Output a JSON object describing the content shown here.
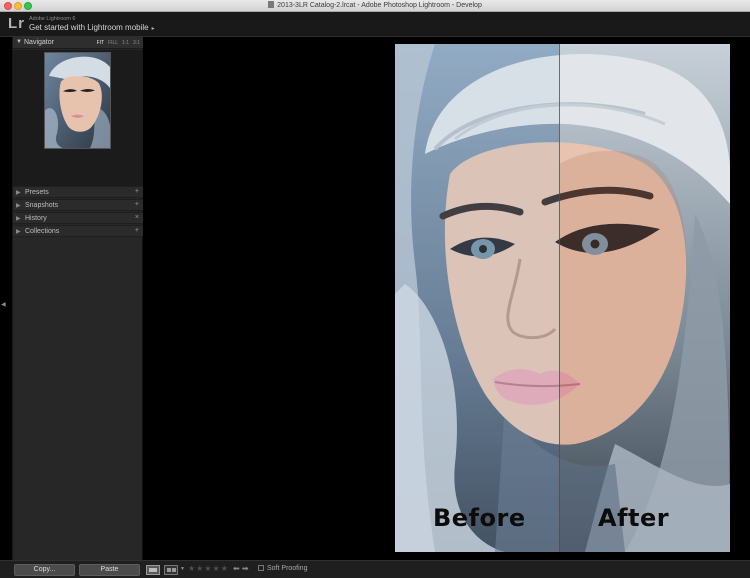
{
  "window": {
    "title": "2013-3LR Catalog-2.lrcat - Adobe Photoshop Lightroom - Develop"
  },
  "identity_plate": {
    "logo": "Lr",
    "version": "Adobe Lightroom 6",
    "mobile_link": "Get started with Lightroom mobile",
    "caret": "▸"
  },
  "navigator": {
    "title": "Navigator",
    "zoom_options": [
      "FIT",
      "FILL",
      "1:1",
      "3:1"
    ],
    "selected_zoom": "FIT"
  },
  "panels": [
    {
      "label": "Presets",
      "action": "+"
    },
    {
      "label": "Snapshots",
      "action": "+"
    },
    {
      "label": "History",
      "action": "×"
    },
    {
      "label": "Collections",
      "action": "+"
    }
  ],
  "main": {
    "before_label": "Before",
    "after_label": "After"
  },
  "bottom_bar": {
    "copy_label": "Copy...",
    "paste_label": "Paste",
    "stars": "★★★★★",
    "arrows": "⬅ ➡",
    "soft_proofing_label": "Soft Proofing"
  },
  "icons": {
    "panel_collapsed": "triangle-right-icon",
    "panel_expanded": "triangle-down-icon",
    "left_collapse": "triangle-left-icon"
  },
  "colors": {
    "panel_bg": "#272727",
    "canvas_bg": "#000000",
    "identity_bg": "#191919",
    "accent_text": "#d6d6d6"
  }
}
